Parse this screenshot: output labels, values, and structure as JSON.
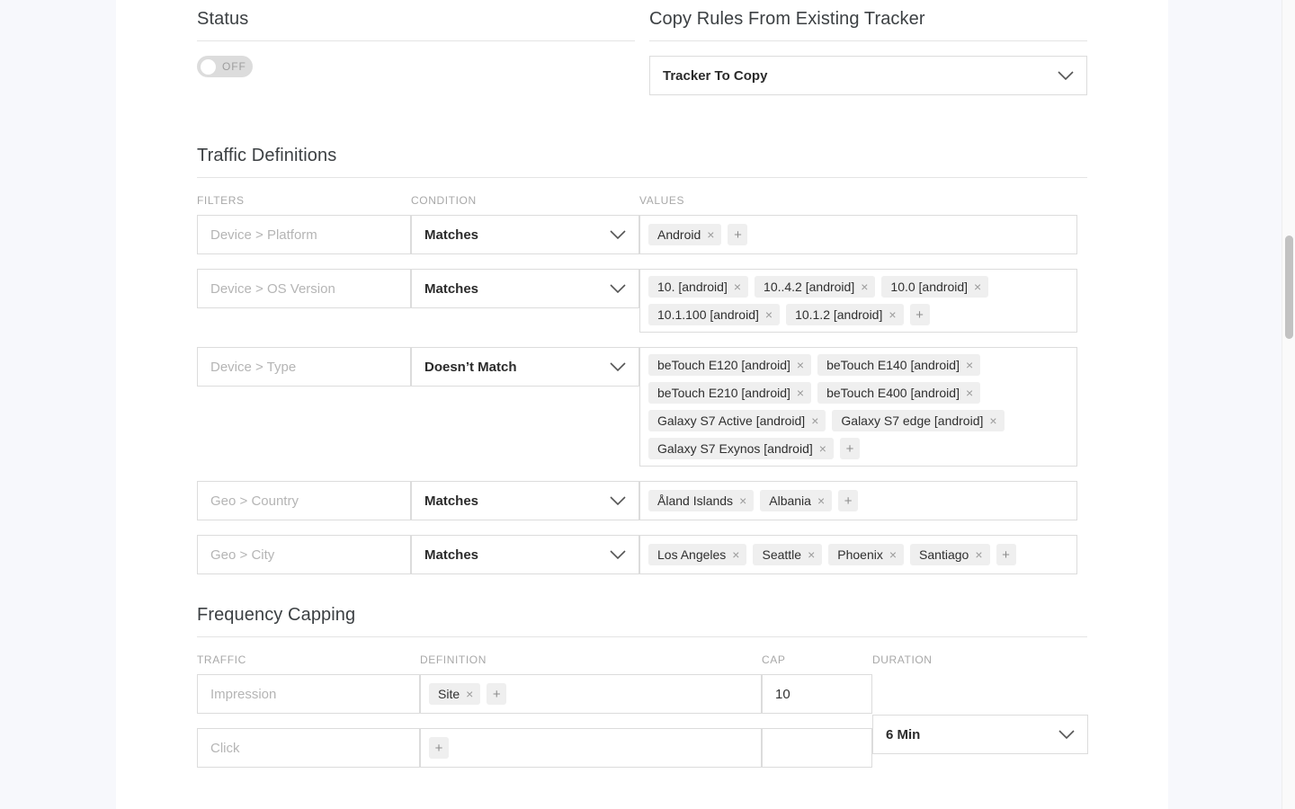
{
  "status": {
    "heading": "Status",
    "toggle_label": "OFF",
    "toggle_state": "off"
  },
  "copy_rules": {
    "heading": "Copy Rules From Existing Tracker",
    "select_value": "Tracker To Copy"
  },
  "traffic_definitions": {
    "heading": "Traffic Definitions",
    "columns": {
      "filters": "FILTERS",
      "condition": "CONDITION",
      "values": "VALUES"
    },
    "add_label": "+",
    "remove_label": "×",
    "rows": [
      {
        "filter_placeholder": "Device > Platform",
        "condition": "Matches",
        "values": [
          "Android"
        ]
      },
      {
        "filter_placeholder": "Device > OS Version",
        "condition": "Matches",
        "values": [
          "10. [android]",
          "10..4.2 [android]",
          "10.0 [android]",
          "10.1.100 [android]",
          "10.1.2 [android]"
        ]
      },
      {
        "filter_placeholder": "Device > Type",
        "condition": "Doesn’t Match",
        "values": [
          "beTouch E120 [android]",
          "beTouch E140 [android]",
          "beTouch E210 [android]",
          "beTouch E400 [android]",
          "Galaxy S7 Active [android]",
          "Galaxy S7 edge [android]",
          "Galaxy S7 Exynos [android]"
        ]
      },
      {
        "filter_placeholder": "Geo > Country",
        "condition": "Matches",
        "values": [
          "Åland Islands",
          "Albania"
        ]
      },
      {
        "filter_placeholder": "Geo > City",
        "condition": "Matches",
        "values": [
          "Los Angeles",
          "Seattle",
          "Phoenix",
          "Santiago"
        ]
      }
    ]
  },
  "frequency_capping": {
    "heading": "Frequency Capping",
    "columns": {
      "traffic": "TRAFFIC",
      "definition": "DEFINITION",
      "cap": "CAP",
      "duration": "DURATION"
    },
    "rows": [
      {
        "traffic_placeholder": "Impression",
        "definition_values": [
          "Site"
        ],
        "cap_value": "10"
      },
      {
        "traffic_placeholder": "Click",
        "definition_values": [],
        "cap_value": ""
      }
    ],
    "duration_value": "6 Min"
  },
  "colors": {
    "page_background": "#f7f8fc",
    "card_background": "#ffffff",
    "border": "#dcdcdc",
    "tag_background": "#efefef",
    "label_text": "#a8a8a8",
    "heading_text": "#3c4043"
  }
}
